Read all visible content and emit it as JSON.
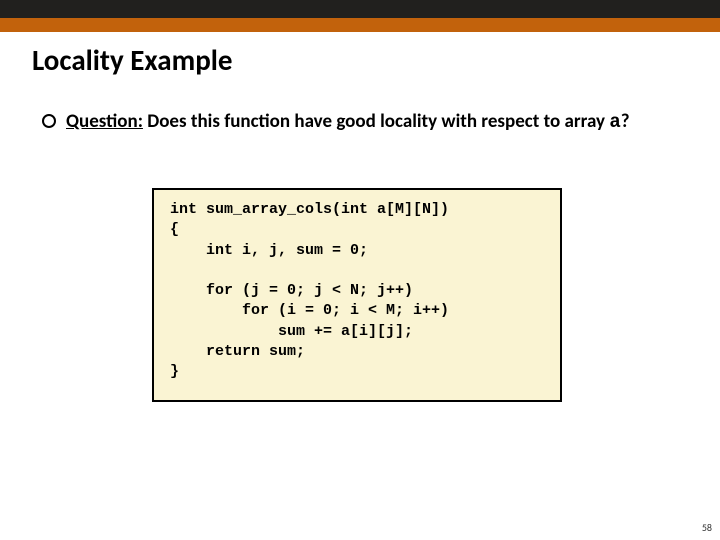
{
  "slide": {
    "title": "Locality Example",
    "page_number": "58"
  },
  "question": {
    "label": "Question:",
    "text_before_var": " Does this function have good locality with respect to array ",
    "var": "a",
    "text_after_var": "?"
  },
  "code": "int sum_array_cols(int a[M][N])\n{\n    int i, j, sum = 0;\n\n    for (j = 0; j < N; j++)\n        for (i = 0; i < M; i++)\n            sum += a[i][j];\n    return sum;\n}"
}
